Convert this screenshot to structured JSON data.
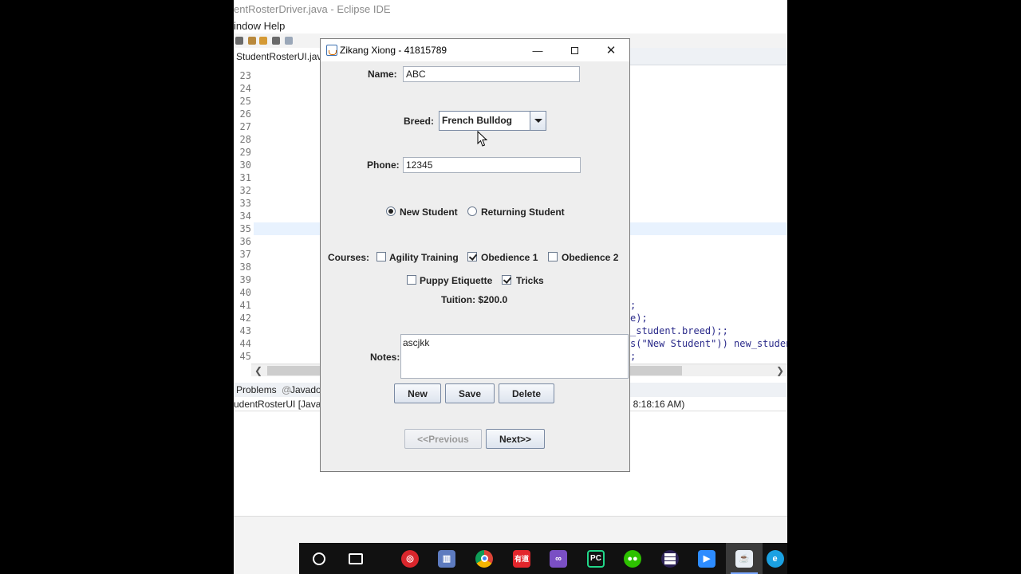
{
  "eclipse": {
    "window_title": "entRosterDriver.java - Eclipse IDE",
    "menu": "indow  Help",
    "editor_tab": "StudentRosterUI.java",
    "line_numbers": [
      "23",
      "24",
      "25",
      "26",
      "27",
      "28",
      "29",
      "30",
      "31",
      "32",
      "33",
      "34",
      "35",
      "36",
      "37",
      "38",
      "39",
      "40",
      "41",
      "42",
      "43",
      "44",
      "45"
    ],
    "code_lines": [
      {
        "row": 18,
        "text": ";"
      },
      {
        "row": 19,
        "text": "e);"
      },
      {
        "row": 20,
        "text": "_student.breed);;"
      },
      {
        "row": 21,
        "text": "s(\"New Student\")) new_studen"
      },
      {
        "row": 22,
        "text": ";"
      }
    ],
    "panel_tabs": {
      "problems": "Problems",
      "javadoc": "Javado"
    },
    "console_left": "udentRosterUI [Java A",
    "console_right": ", 8:18:16 AM)"
  },
  "dialog": {
    "title": "Zikang Xiong - 41815789",
    "name_label": "Name:",
    "name_value": "ABC",
    "breed_label": "Breed:",
    "breed_value": "French Bulldog",
    "phone_label": "Phone:",
    "phone_value": "12345",
    "radio_new": "New Student",
    "radio_returning": "Returning Student",
    "courses_label": "Courses:",
    "course_agility": "Agility Training",
    "course_obedience1": "Obedience 1",
    "course_obedience2": "Obedience 2",
    "course_puppy": "Puppy Etiquette",
    "course_tricks": "Tricks",
    "tuition": "Tuition: $200.0",
    "notes_label": "Notes:",
    "notes_value": "ascjkk",
    "btn_new": "New",
    "btn_save": "Save",
    "btn_delete": "Delete",
    "btn_previous": "<<Previous",
    "btn_next": "Next>>"
  },
  "taskbar": {
    "apps": [
      "task-view",
      "netease-music",
      "library",
      "chrome",
      "youdao-dict",
      "visual-studio",
      "pycharm",
      "wechat",
      "eclipse",
      "zoom",
      "java",
      "ie"
    ],
    "youdao_label": "有道"
  }
}
